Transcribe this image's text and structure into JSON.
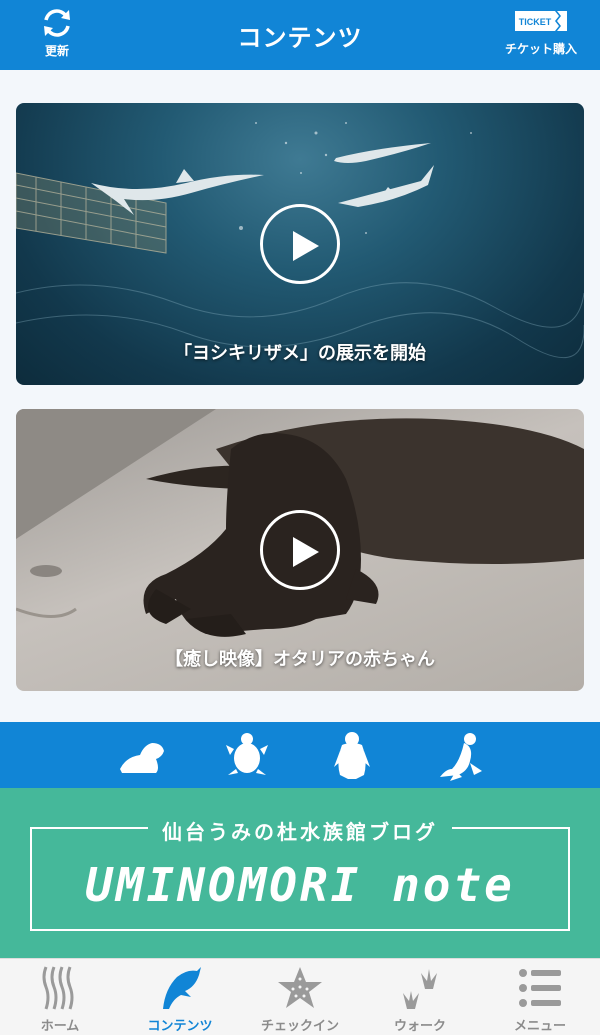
{
  "header": {
    "refresh_label": "更新",
    "title": "コンテンツ",
    "ticket_badge": "TICKET",
    "ticket_label": "チケット購入"
  },
  "videos": [
    {
      "caption": "「ヨシキリザメ」の展示を開始"
    },
    {
      "caption": "【癒し映像】オタリアの赤ちゃん"
    }
  ],
  "animal_banner": {
    "icons": [
      "seal-icon",
      "turtle-icon",
      "penguin-icon",
      "sea-lion-icon"
    ]
  },
  "blog": {
    "subtitle": "仙台うみの杜水族館ブログ",
    "title": "UMINOMORI note"
  },
  "tabs": [
    {
      "label": "ホーム",
      "icon": "home-icon",
      "active": false
    },
    {
      "label": "コンテンツ",
      "icon": "dolphin-icon",
      "active": true
    },
    {
      "label": "チェックイン",
      "icon": "starfish-icon",
      "active": false
    },
    {
      "label": "ウォーク",
      "icon": "footprint-icon",
      "active": false
    },
    {
      "label": "メニュー",
      "icon": "menu-icon",
      "active": false
    }
  ],
  "colors": {
    "primary": "#1185d6",
    "blog_green": "#45b89a",
    "tab_inactive": "#8b8b8b"
  }
}
